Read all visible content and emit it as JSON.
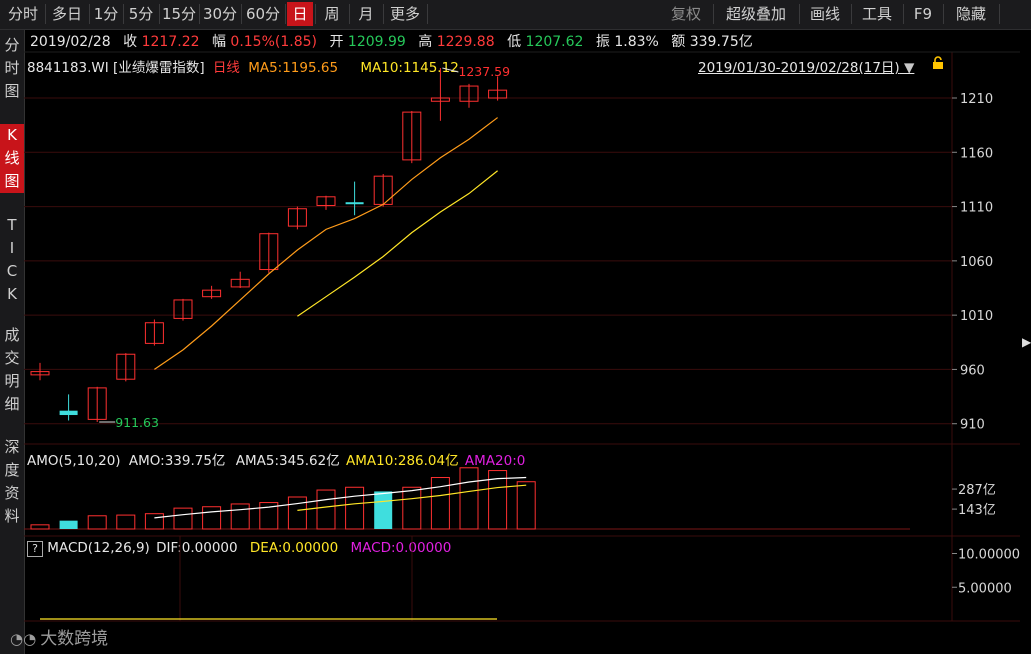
{
  "toolbar": {
    "items": [
      "分时",
      "多日",
      "1分",
      "5分",
      "15分",
      "30分",
      "60分",
      "日",
      "周",
      "月",
      "更多"
    ],
    "active": "日",
    "right_items": [
      "复权",
      "超级叠加",
      "画线",
      "工具",
      "F9",
      "隐藏"
    ]
  },
  "left_tabs": [
    "分时图",
    "K线图",
    "TICK",
    "成交明细",
    "深度资料"
  ],
  "quote": {
    "date": "2019/02/28",
    "close_label": "收",
    "close": "1217.22",
    "change_label": "幅",
    "change": "0.15%(1.85)",
    "open_label": "开",
    "open": "1209.99",
    "high_label": "高",
    "high": "1229.88",
    "low_label": "低",
    "low": "1207.62",
    "amplitude_label": "振",
    "amplitude": "1.83%",
    "amount_label": "额",
    "amount": "339.75亿"
  },
  "kline_header": {
    "code": "8841183.WI",
    "name": "[业绩爆雷指数]",
    "period": "日线",
    "ma5": "MA5:1195.65",
    "ma10": "MA10:1145.12",
    "range": "2019/01/30-2019/02/28(17日)"
  },
  "volume_header": {
    "amo": "AMO(5,10,20)",
    "amo_val": "AMO:339.75亿",
    "ama5": "AMA5:345.62亿",
    "ama10": "AMA10:286.04亿",
    "ama20": "AMA20:0"
  },
  "macd_header": {
    "help": "?",
    "name": "MACD(12,26,9)",
    "dif": "DIF:0.00000",
    "dea": "DEA:0.00000",
    "macd": "MACD:0.00000"
  },
  "watermark": "大数跨境",
  "colors": {
    "up": "#ff3030",
    "down": "#3fdede",
    "ma5": "#ff9c1a",
    "ma10": "#ffe627",
    "ama20": "#e020e0",
    "grid": "#3a0c0c"
  },
  "chart_data": [
    {
      "type": "candlestick",
      "title": "8841183.WI [业绩爆雷指数] 日线",
      "yticks": [
        910,
        960,
        1010,
        1060,
        1110,
        1160,
        1210
      ],
      "ylim": [
        895,
        1245
      ],
      "candles": [
        {
          "o": 955,
          "h": 966,
          "l": 950,
          "c": 958
        },
        {
          "o": 922,
          "h": 937,
          "l": 913,
          "c": 918
        },
        {
          "o": 914,
          "h": 944,
          "l": 911.63,
          "c": 943
        },
        {
          "o": 951,
          "h": 975,
          "l": 949,
          "c": 974
        },
        {
          "o": 984,
          "h": 1006,
          "l": 982,
          "c": 1003
        },
        {
          "o": 1007,
          "h": 1025,
          "l": 1005,
          "c": 1024
        },
        {
          "o": 1027,
          "h": 1037,
          "l": 1025,
          "c": 1033
        },
        {
          "o": 1036,
          "h": 1050,
          "l": 1035,
          "c": 1043
        },
        {
          "o": 1052,
          "h": 1086,
          "l": 1049,
          "c": 1085
        },
        {
          "o": 1092,
          "h": 1110,
          "l": 1089,
          "c": 1108
        },
        {
          "o": 1111,
          "h": 1120,
          "l": 1107,
          "c": 1119
        },
        {
          "o": 1114,
          "h": 1133,
          "l": 1102,
          "c": 1113
        },
        {
          "o": 1112,
          "h": 1140,
          "l": 1110,
          "c": 1138
        },
        {
          "o": 1153,
          "h": 1198,
          "l": 1150,
          "c": 1197
        },
        {
          "o": 1207,
          "h": 1237.59,
          "l": 1189,
          "c": 1210
        },
        {
          "o": 1207,
          "h": 1223,
          "l": 1201,
          "c": 1221
        },
        {
          "o": 1209.99,
          "h": 1229.88,
          "l": 1207.62,
          "c": 1217.22
        }
      ],
      "high_label": "1237.59",
      "low_label": "911.63",
      "ma5": [
        null,
        null,
        null,
        null,
        960,
        978,
        1000,
        1024,
        1048,
        1070,
        1089,
        1099,
        1112,
        1135,
        1155,
        1172,
        1192
      ],
      "ma10": [
        null,
        null,
        null,
        null,
        null,
        null,
        null,
        null,
        null,
        1009,
        1027,
        1045,
        1064,
        1086,
        1105,
        1122,
        1143
      ]
    },
    {
      "type": "bar",
      "title": "AMO(5,10,20)",
      "unit": "亿",
      "yticks": [
        143,
        287
      ],
      "ylim": [
        0,
        460
      ],
      "values": [
        30,
        60,
        95,
        100,
        110,
        150,
        160,
        180,
        190,
        230,
        280,
        300,
        270,
        300,
        370,
        440,
        420,
        339.75
      ],
      "direction": [
        "up",
        "down",
        "up",
        "up",
        "up",
        "up",
        "up",
        "up",
        "up",
        "up",
        "up",
        "up",
        "down",
        "up",
        "up",
        "up",
        "up",
        "up"
      ],
      "ama5": [
        null,
        null,
        null,
        null,
        80,
        103,
        123,
        139,
        157,
        183,
        211,
        236,
        255,
        276,
        304,
        338,
        362,
        370
      ],
      "ama10": [
        null,
        null,
        null,
        null,
        null,
        null,
        null,
        null,
        null,
        134,
        158,
        181,
        198,
        218,
        241,
        270,
        298,
        315
      ]
    },
    {
      "type": "line",
      "title": "MACD(12,26,9)",
      "yticks": [
        5,
        10
      ],
      "ylim": [
        0,
        12
      ]
    }
  ]
}
